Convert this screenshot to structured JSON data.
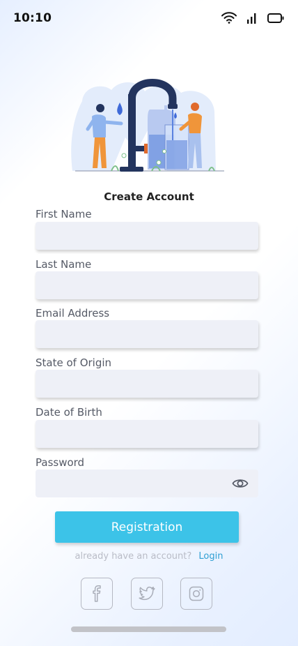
{
  "status_bar": {
    "time": "10:10"
  },
  "form": {
    "title": "Create Account",
    "fields": [
      {
        "label": "First Name",
        "value": ""
      },
      {
        "label": "Last Name",
        "value": ""
      },
      {
        "label": "Email Address",
        "value": ""
      },
      {
        "label": "State of Origin",
        "value": ""
      },
      {
        "label": "Date of Birth",
        "value": ""
      },
      {
        "label": "Password",
        "value": ""
      }
    ],
    "submit_label": "Registration",
    "login_prompt": "already have an account?",
    "login_link": "Login"
  },
  "social": [
    {
      "icon": "facebook-icon"
    },
    {
      "icon": "twitter-icon"
    },
    {
      "icon": "instagram-icon"
    }
  ],
  "colors": {
    "accent": "#3cc3e8",
    "link": "#2f9fd3",
    "field_bg": "#eef0f7"
  }
}
